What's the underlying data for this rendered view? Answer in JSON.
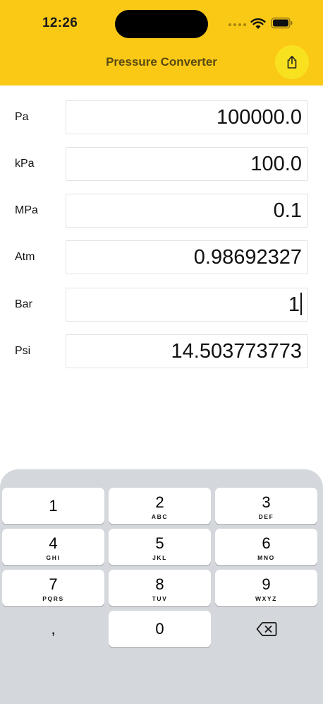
{
  "status_bar": {
    "time": "12:26"
  },
  "nav": {
    "title": "Pressure Converter",
    "share_icon": "share-icon"
  },
  "rows": [
    {
      "label": "Pa",
      "value": "100000.0"
    },
    {
      "label": "kPa",
      "value": "100.0"
    },
    {
      "label": "MPa",
      "value": "0.1"
    },
    {
      "label": "Atm",
      "value": "0.98692327"
    },
    {
      "label": "Bar",
      "value": "1"
    },
    {
      "label": "Psi",
      "value": "14.503773773"
    }
  ],
  "keypad": {
    "keys": [
      {
        "num": "1",
        "letters": ""
      },
      {
        "num": "2",
        "letters": "ABC"
      },
      {
        "num": "3",
        "letters": "DEF"
      },
      {
        "num": "4",
        "letters": "GHI"
      },
      {
        "num": "5",
        "letters": "JKL"
      },
      {
        "num": "6",
        "letters": "MNO"
      },
      {
        "num": "7",
        "letters": "PQRS"
      },
      {
        "num": "8",
        "letters": "TUV"
      },
      {
        "num": "9",
        "letters": "WXYZ"
      },
      {
        "num": "0",
        "letters": ""
      }
    ],
    "comma": ",",
    "delete_icon": "backspace-icon"
  },
  "colors": {
    "header": "#FAC916",
    "share_button": "#F8E220",
    "keyboard_bg": "#D4D7DC"
  }
}
